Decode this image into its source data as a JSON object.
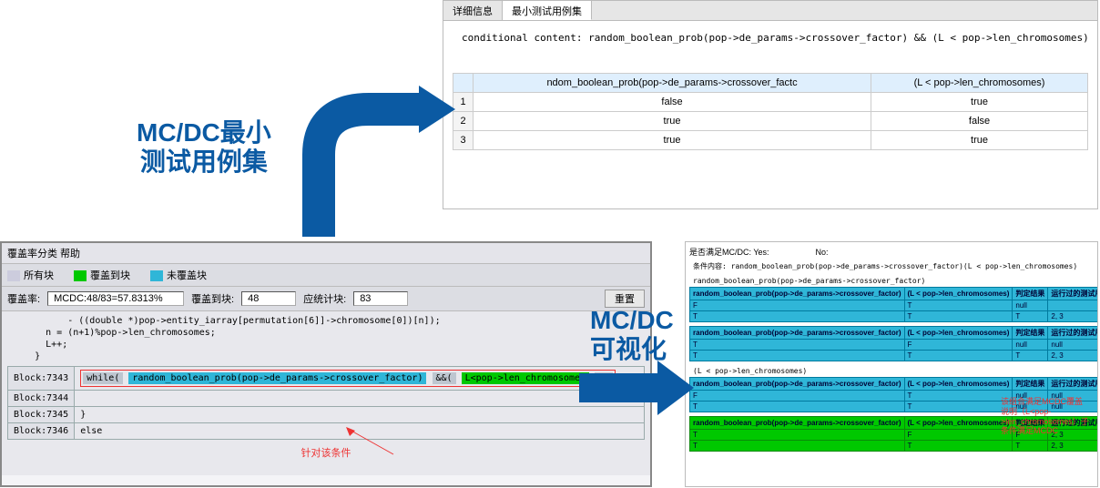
{
  "labels": {
    "mcdc_min_set_line1": "MC/DC最小",
    "mcdc_min_set_line2": "测试用例集",
    "mcdc_vis_line1": "MC/DC",
    "mcdc_vis_line2": "可视化"
  },
  "tabs_panel": {
    "tabs": [
      "详细信息",
      "最小测试用例集"
    ],
    "active_tab": 1,
    "conditional_label": "conditional content:",
    "conditional_content": "random_boolean_prob(pop->de_params->crossover_factor) && (L < pop->len_chromosomes)",
    "table": {
      "columns": [
        "ndom_boolean_prob(pop->de_params->crossover_factc",
        "(L < pop->len_chromosomes)"
      ],
      "rows": [
        {
          "n": "1",
          "c1": "false",
          "c2": "true"
        },
        {
          "n": "2",
          "c1": "true",
          "c2": "false"
        },
        {
          "n": "3",
          "c1": "true",
          "c2": "true"
        }
      ]
    }
  },
  "cov_panel": {
    "menu": "覆盖率分类  帮助",
    "legend": {
      "all": "所有块",
      "covered": "覆盖到块",
      "uncovered": "未覆盖块",
      "color_covered": "#00c800",
      "color_uncovered": "#2fb6d8"
    },
    "stats": {
      "rate_label": "覆盖率:",
      "rate_value": "MCDC:48/83=57.8313%",
      "covered_label": "覆盖到块:",
      "covered_value": "48",
      "total_label": "应统计块:",
      "total_value": "83",
      "reset_btn": "重置"
    },
    "src_pre": [
      "           - ((double *)pop->entity_iarray[permutation[6]]->chromosome[0])[n]);",
      "       n = (n+1)%pop->len_chromosomes;",
      "       L++;",
      "     }"
    ],
    "blocks": [
      {
        "label": "Block:7343",
        "kind": "cond",
        "prefix": "while(",
        "c1": "random_boolean_prob(pop->de_params->crossover_factor)",
        "op": "&&(",
        "c2": "L<pop->len_chromosomes",
        "suffix": ");"
      },
      {
        "label": "Block:7344",
        "kind": "plain",
        "text": ""
      },
      {
        "label": "Block:7345",
        "kind": "plain",
        "text": "          }"
      },
      {
        "label": "Block:7346",
        "kind": "plain",
        "text": "            else"
      }
    ],
    "callout": "针对该条件"
  },
  "vis_panel": {
    "head_label": "是否满足MC/DC:",
    "yes_label": "Yes:",
    "no_label": "No:",
    "cond_label": "条件内容:",
    "cond_text": "random_boolean_prob(pop->de_params->crossover_factor)(L < pop->len_chromosomes)",
    "sub1": "random_boolean_prob(pop->de_params->crossover_factor)",
    "sub2": "(L < pop->len_chromosomes)",
    "mini_cols": [
      "random_boolean_prob(pop->de_params->crossover_factor)",
      "(L < pop->len_chromosomes)",
      "判定结果",
      "运行过的测试用例"
    ],
    "blue_tbl_1_rows": [
      {
        "a": "F",
        "b": "T",
        "r": "null",
        "t": ""
      },
      {
        "a": "T",
        "b": "T",
        "r": "T",
        "t": "2, 3"
      }
    ],
    "blue_tbl_2_rows": [
      {
        "a": "T",
        "b": "F",
        "r": "null",
        "t": "null"
      },
      {
        "a": "T",
        "b": "T",
        "r": "T",
        "t": "2, 3"
      }
    ],
    "blue_tbl_3_rows": [
      {
        "a": "F",
        "b": "T",
        "r": "null",
        "t": "null"
      },
      {
        "a": "T",
        "b": "T",
        "r": "null",
        "t": "null"
      }
    ],
    "green_tbl_rows": [
      {
        "a": "T",
        "b": "F",
        "r": "F",
        "t": "2, 3"
      },
      {
        "a": "T",
        "b": "T",
        "r": "T",
        "t": "2, 3"
      }
    ],
    "note": "该组合满足MCDC覆盖 说明（L<pop->len_chromosomes）子条件满足MCDC"
  }
}
